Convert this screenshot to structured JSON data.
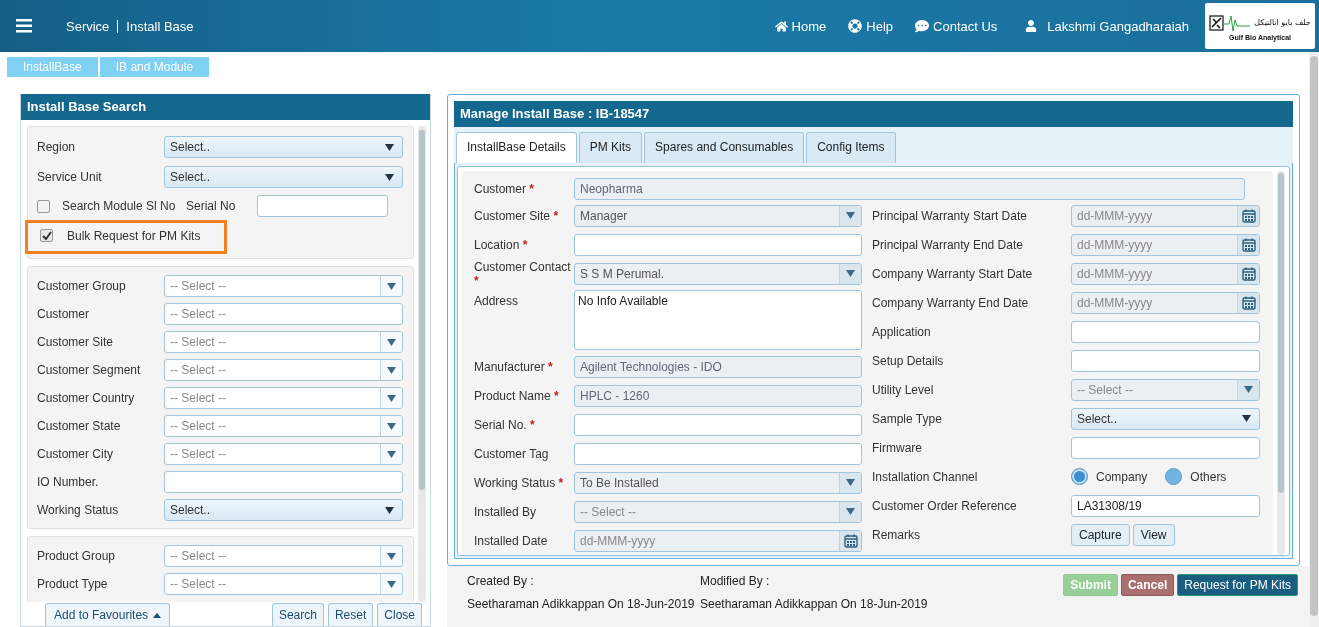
{
  "header": {
    "breadcrumb": [
      "Service",
      "Install Base"
    ],
    "nav": [
      {
        "kind": "home",
        "label": "Home"
      },
      {
        "kind": "help",
        "label": "Help"
      },
      {
        "kind": "contact",
        "label": "Contact Us"
      },
      {
        "kind": "user",
        "label": "Lakshmi Gangadharaiah"
      }
    ],
    "logo": {
      "arabic": "جلف بايو انالتيكل",
      "name": "Gulf Bio Analytical"
    }
  },
  "subtabs": [
    "InstallBase",
    "IB and Module"
  ],
  "search_panel": {
    "title": "Install Base Search",
    "sections": [
      [
        {
          "kind": "dropdown",
          "label": "Region",
          "value": "Select.."
        },
        {
          "kind": "dropdown",
          "label": "Service Unit",
          "value": "Select.."
        },
        {
          "kind": "module_search",
          "label": "Search Module Sl No",
          "checked": false,
          "serial_label": "Serial No"
        },
        {
          "kind": "checkbox",
          "label": "Bulk Request for PM Kits",
          "checked": true,
          "highlighted": true
        }
      ],
      [
        {
          "kind": "combo",
          "label": "Customer Group",
          "placeholder": "-- Select --"
        },
        {
          "kind": "text",
          "label": "Customer",
          "placeholder": "-- Select --"
        },
        {
          "kind": "combo",
          "label": "Customer Site",
          "placeholder": "-- Select --"
        },
        {
          "kind": "combo",
          "label": "Customer Segment",
          "placeholder": "-- Select --"
        },
        {
          "kind": "combo",
          "label": "Customer Country",
          "placeholder": "-- Select --"
        },
        {
          "kind": "combo",
          "label": "Customer State",
          "placeholder": "-- Select --"
        },
        {
          "kind": "combo",
          "label": "Customer City",
          "placeholder": "-- Select --"
        },
        {
          "kind": "text",
          "label": "IO Number."
        },
        {
          "kind": "dropdown",
          "label": "Working Status",
          "value": "Select.."
        }
      ],
      [
        {
          "kind": "combo",
          "label": "Product Group",
          "placeholder": "-- Select --"
        },
        {
          "kind": "combo",
          "label": "Product Type",
          "placeholder": "-- Select --"
        }
      ]
    ],
    "favourites": "Add to Favourites",
    "buttons": [
      "Search",
      "Reset",
      "Close"
    ]
  },
  "manage_panel": {
    "title": "Manage Install Base : IB-18547",
    "tabs": [
      {
        "label": "InstallBase Details",
        "selected": true
      },
      {
        "label": "PM Kits",
        "selected": false
      },
      {
        "label": "Spares and Consumables",
        "selected": false
      },
      {
        "label": "Config Items",
        "selected": false
      }
    ],
    "customer": {
      "kind": "text",
      "label": "Customer",
      "required_mark": "*",
      "disabled": true,
      "value": "Neopharma"
    },
    "left_fields": [
      {
        "kind": "combo",
        "label": "Customer Site",
        "required_mark": "*",
        "disabled": true,
        "value": "Manager"
      },
      {
        "kind": "text",
        "label": "Location",
        "required_mark": "*",
        "disabled": false
      },
      {
        "kind": "combo",
        "label": "Customer Contact",
        "required_mark": "*",
        "disabled": true,
        "value": "S S M  Perumal."
      },
      {
        "kind": "textarea",
        "label": "Address",
        "value": "No Info Available"
      },
      {
        "kind": "text",
        "label": "Manufacturer",
        "required_mark": "*",
        "disabled": true,
        "value": "Agilent Technologies - IDO"
      },
      {
        "kind": "text",
        "label": "Product Name",
        "required_mark": "*",
        "disabled": true,
        "value": "HPLC - 1260"
      },
      {
        "kind": "text",
        "label": "Serial No.",
        "required_mark": "*",
        "disabled": false
      },
      {
        "kind": "text",
        "label": "Customer Tag",
        "disabled": false
      },
      {
        "kind": "combo",
        "label": "Working Status",
        "required_mark": "*",
        "disabled": true,
        "value": "To Be Installed"
      },
      {
        "kind": "combo",
        "label": "Installed By",
        "disabled": true,
        "placeholder": "-- Select --"
      },
      {
        "kind": "date",
        "label": "Installed Date",
        "disabled": true,
        "placeholder": "dd-MMM-yyyy"
      }
    ],
    "right_fields": [
      {
        "kind": "date",
        "label": "Principal Warranty Start Date",
        "disabled": true,
        "placeholder": "dd-MMM-yyyy"
      },
      {
        "kind": "date",
        "label": "Principal Warranty End Date",
        "disabled": true,
        "placeholder": "dd-MMM-yyyy"
      },
      {
        "kind": "date",
        "label": "Company Warranty Start Date",
        "disabled": true,
        "placeholder": "dd-MMM-yyyy"
      },
      {
        "kind": "date",
        "label": "Company Warranty End Date",
        "disabled": true,
        "placeholder": "dd-MMM-yyyy"
      },
      {
        "kind": "text",
        "label": "Application",
        "disabled": false
      },
      {
        "kind": "text",
        "label": "Setup Details",
        "disabled": false
      },
      {
        "kind": "combo",
        "label": "Utility Level",
        "disabled": true,
        "placeholder": "-- Select --"
      },
      {
        "kind": "dropdown",
        "label": "Sample Type",
        "value": "Select.."
      },
      {
        "kind": "text",
        "label": "Firmware",
        "disabled": false
      },
      {
        "kind": "radio",
        "label": "Installation Channel",
        "options": [
          {
            "label": "Company",
            "selected": true
          },
          {
            "label": "Others",
            "selected": false
          }
        ]
      },
      {
        "kind": "text",
        "label": "Customer Order Reference",
        "disabled": false,
        "value": "LA31308/19"
      },
      {
        "kind": "buttons",
        "label": "Remarks",
        "buttons": [
          "Capture",
          "View"
        ]
      }
    ],
    "created": {
      "label": "Created By :",
      "value": "Seetharaman Adikkappan On 18-Jun-2019"
    },
    "modified": {
      "label": "Modified By :",
      "value": "Seetharaman Adikkappan On 18-Jun-2019"
    },
    "actions": [
      {
        "kind": "submit",
        "label": "Submit",
        "disabled": true
      },
      {
        "kind": "cancel",
        "label": "Cancel",
        "disabled": false
      },
      {
        "kind": "primary",
        "label": "Request for PM Kits",
        "disabled": false
      }
    ]
  }
}
